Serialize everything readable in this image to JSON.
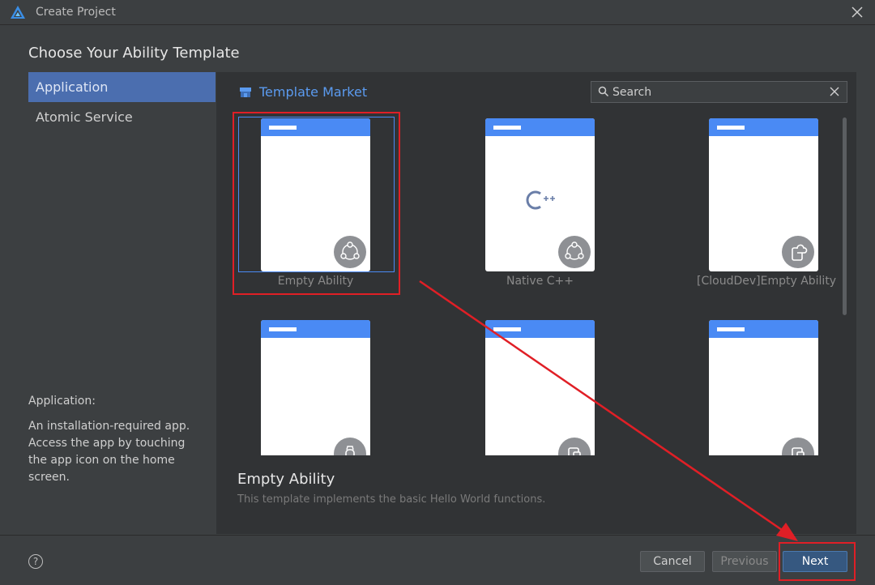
{
  "window": {
    "title": "Create Project"
  },
  "heading": "Choose Your Ability Template",
  "sidebar": {
    "items": [
      {
        "label": "Application",
        "active": true
      },
      {
        "label": "Atomic Service",
        "active": false
      }
    ]
  },
  "description": {
    "title": "Application:",
    "text": "An installation-required app. Access the app by touching the app icon on the home screen."
  },
  "market": {
    "label": "Template Market"
  },
  "search": {
    "placeholder": "Search"
  },
  "templates": [
    {
      "label": "Empty Ability",
      "badge_icon": "share-nodes-icon"
    },
    {
      "label": "Native C++",
      "badge_icon": "share-nodes-icon",
      "center_icon": "cpp-icon"
    },
    {
      "label": "[CloudDev]Empty Ability",
      "badge_icon": "cloud-device-icon"
    },
    {
      "label": "",
      "badge_icon": "watch-icon"
    },
    {
      "label": "",
      "badge_icon": "devices-icon"
    },
    {
      "label": "",
      "badge_icon": "devices-icon"
    }
  ],
  "selected_template": {
    "title": "Empty Ability",
    "description": "This template implements the basic Hello World functions."
  },
  "footer": {
    "help": "?",
    "cancel": "Cancel",
    "previous": "Previous",
    "next": "Next"
  },
  "colors": {
    "accent": "#4a8af4",
    "annotation": "#e01f26",
    "primary_button": "#365880"
  }
}
